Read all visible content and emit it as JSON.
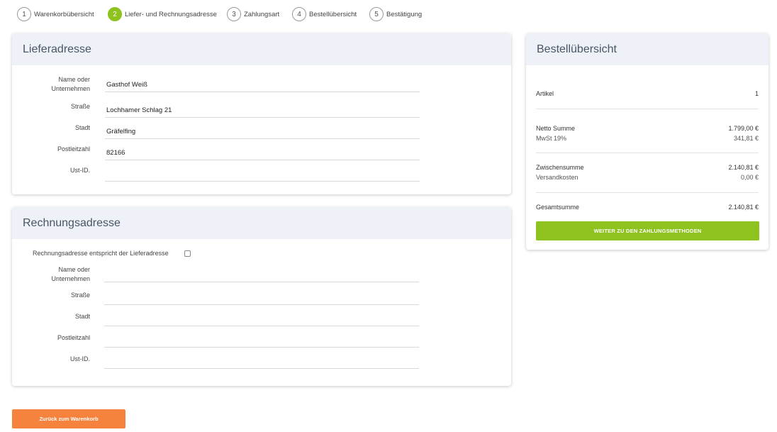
{
  "stepper": {
    "steps": [
      {
        "num": "1",
        "label": "Warenkorbübersicht"
      },
      {
        "num": "2",
        "label": "Liefer- und Rechnungsadresse"
      },
      {
        "num": "3",
        "label": "Zahlungsart"
      },
      {
        "num": "4",
        "label": "Bestellübersicht"
      },
      {
        "num": "5",
        "label": "Bestätigung"
      }
    ],
    "active_step": 2
  },
  "delivery": {
    "title": "Lieferadresse",
    "name_label_1": "Name oder",
    "name_label_2": "Unternehmen",
    "name_value": "Gasthof Weiß",
    "street_label": "Straße",
    "street_value": "Lochhamer Schlag 21",
    "city_label": "Stadt",
    "city_value": "Gräfelfing",
    "zip_label": "Postleitzahl",
    "zip_value": "82166",
    "vat_label": "Ust-ID.",
    "vat_value": ""
  },
  "billing": {
    "title": "Rechnungsadresse",
    "same_as_delivery_label": "Rechnungsadresse entspricht der Lieferadresse",
    "same_as_delivery_checked": false,
    "name_label_1": "Name oder",
    "name_label_2": "Unternehmen",
    "street_label": "Straße",
    "city_label": "Stadt",
    "zip_label": "Postleitzahl",
    "vat_label": "Ust-ID."
  },
  "summary": {
    "title": "Bestellübersicht",
    "items_label": "Artikel",
    "items_value": "1",
    "net_label": "Netto Summe",
    "net_value": "1.799,00 €",
    "vat_label": "MwSt 19%",
    "vat_value": "341,81 €",
    "subtotal_label": "Zwischensumme",
    "subtotal_value": "2.140,81 €",
    "shipping_label": "Versandkosten",
    "shipping_value": "0,00 €",
    "total_label": "Gesamtsumme",
    "total_value": "2.140,81 €",
    "continue_button": "WEITER ZU DEN ZAHLUNGSMETHODEN"
  },
  "back_button": "Zurück zum Warenkorb",
  "colors": {
    "accent_green": "#8dc21f",
    "accent_orange": "#f5823d",
    "header_bg": "#eef2f8"
  }
}
